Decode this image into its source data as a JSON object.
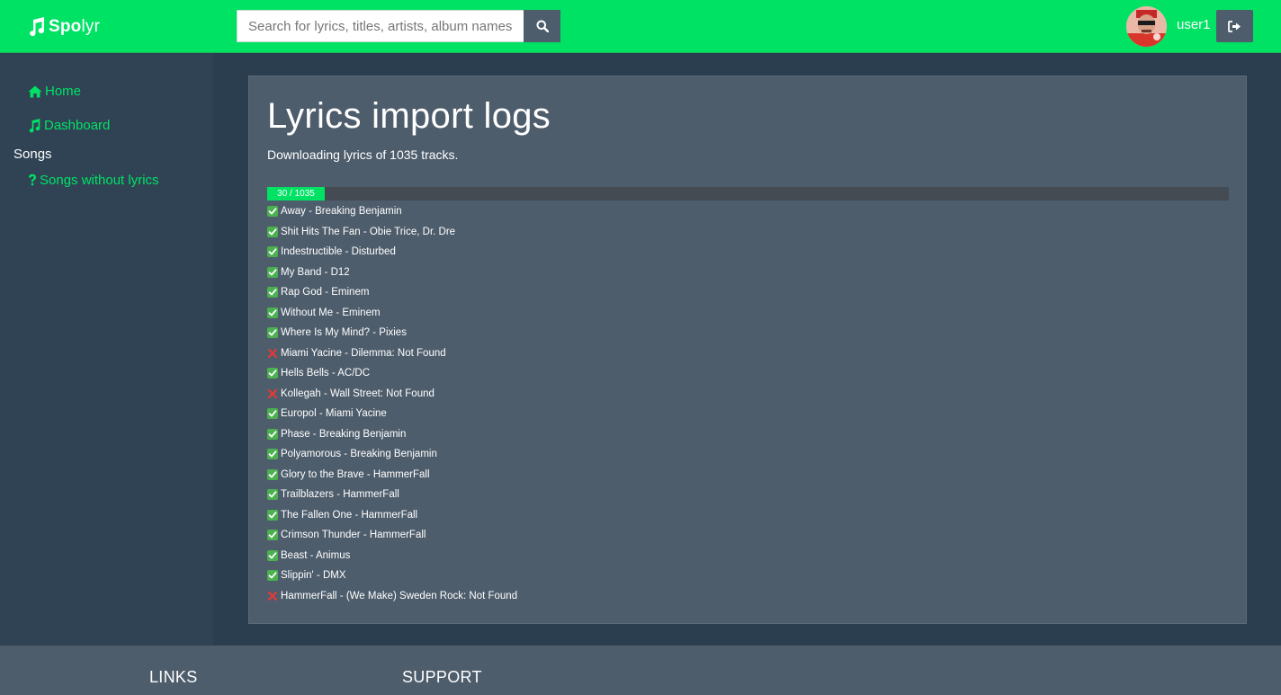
{
  "header": {
    "brand_bold": "Spo",
    "brand_rest": "lyr",
    "search_placeholder": "Search for lyrics, titles, artists, album names ...",
    "username": "user1",
    "brand_color": "#00e264",
    "icons": {
      "brand": "music-note-icon",
      "search": "search-icon",
      "logout": "sign-out-icon"
    }
  },
  "sidebar": {
    "home": "Home",
    "dashboard": "Dashboard",
    "section": "Songs",
    "songs_without_lyrics": "Songs without lyrics",
    "icons": {
      "home": "home-icon",
      "dashboard": "music-note-icon",
      "songs_without_lyrics": "question-icon"
    }
  },
  "main": {
    "title": "Lyrics import logs",
    "subtitle": "Downloading lyrics of 1035 tracks.",
    "progress": {
      "text": "30 / 1035",
      "current": 30,
      "total": 1035
    },
    "log": [
      {
        "status": "ok",
        "text": "Away - Breaking Benjamin"
      },
      {
        "status": "ok",
        "text": "Shit Hits The Fan - Obie Trice, Dr. Dre"
      },
      {
        "status": "ok",
        "text": "Indestructible - Disturbed"
      },
      {
        "status": "ok",
        "text": "My Band - D12"
      },
      {
        "status": "ok",
        "text": "Rap God - Eminem"
      },
      {
        "status": "ok",
        "text": "Without Me - Eminem"
      },
      {
        "status": "ok",
        "text": "Where Is My Mind? - Pixies"
      },
      {
        "status": "fail",
        "text": "Miami Yacine - Dilemma: Not Found"
      },
      {
        "status": "ok",
        "text": "Hells Bells - AC/DC"
      },
      {
        "status": "fail",
        "text": "Kollegah - Wall Street: Not Found"
      },
      {
        "status": "ok",
        "text": "Europol - Miami Yacine"
      },
      {
        "status": "ok",
        "text": "Phase - Breaking Benjamin"
      },
      {
        "status": "ok",
        "text": "Polyamorous - Breaking Benjamin"
      },
      {
        "status": "ok",
        "text": "Glory to the Brave - HammerFall"
      },
      {
        "status": "ok",
        "text": "Trailblazers - HammerFall"
      },
      {
        "status": "ok",
        "text": "The Fallen One - HammerFall"
      },
      {
        "status": "ok",
        "text": "Crimson Thunder - HammerFall"
      },
      {
        "status": "ok",
        "text": "Beast - Animus"
      },
      {
        "status": "ok",
        "text": "Slippin' - DMX"
      },
      {
        "status": "fail",
        "text": "HammerFall - (We Make) Sweden Rock: Not Found"
      }
    ]
  },
  "footer": {
    "links_heading": "LINKS",
    "support_heading": "SUPPORT"
  }
}
